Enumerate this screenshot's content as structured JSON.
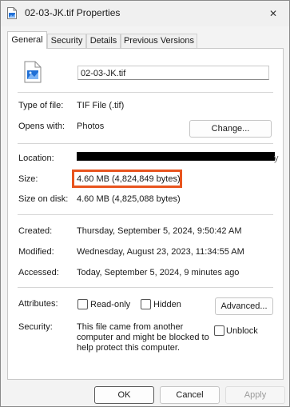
{
  "window": {
    "title": "02-03-JK.tif Properties",
    "close_glyph": "✕"
  },
  "tabs": [
    {
      "label": "General"
    },
    {
      "label": "Security"
    },
    {
      "label": "Details"
    },
    {
      "label": "Previous Versions"
    }
  ],
  "general": {
    "file_name": "02-03-JK.tif",
    "type_label": "Type of file:",
    "type_value": "TIF File (.tif)",
    "opens_label": "Opens with:",
    "opens_value": "Photos",
    "change_button": "Change...",
    "location_label": "Location:",
    "location_trailing": "y",
    "size_label": "Size:",
    "size_value": "4.60 MB (4,824,849 bytes)",
    "size_disk_label": "Size on disk:",
    "size_disk_value": "4.60 MB (4,825,088 bytes)",
    "created_label": "Created:",
    "created_value": "Thursday, September 5, 2024, 9:50:42 AM",
    "modified_label": "Modified:",
    "modified_value": "Wednesday, August 23, 2023, 11:34:55 AM",
    "accessed_label": "Accessed:",
    "accessed_value": "Today, September 5, 2024, 9 minutes ago",
    "attributes_label": "Attributes:",
    "readonly_label": "Read-only",
    "hidden_label": "Hidden",
    "advanced_button": "Advanced...",
    "security_label": "Security:",
    "security_text_1": "This file came from another",
    "security_text_2": "computer and might be blocked to",
    "security_text_3": "help protect this computer.",
    "unblock_label": "Unblock"
  },
  "buttons": {
    "ok": "OK",
    "cancel": "Cancel",
    "apply": "Apply"
  },
  "colors": {
    "highlight": "#e8541e",
    "icon_blue": "#1f6fd6"
  }
}
